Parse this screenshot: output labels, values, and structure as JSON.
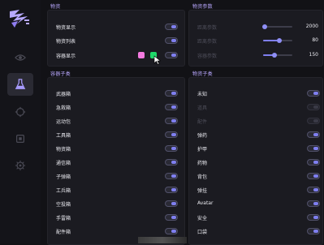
{
  "sidebar": {
    "logo": "app-logo",
    "items": [
      {
        "icon": "eye-icon",
        "active": false
      },
      {
        "icon": "flask-icon",
        "active": true
      },
      {
        "icon": "crosshair-icon",
        "active": false
      },
      {
        "icon": "chip-icon",
        "active": false
      },
      {
        "icon": "gear-icon",
        "active": false
      }
    ]
  },
  "item_display": {
    "title": "物资",
    "rows": [
      {
        "label": "物资显示",
        "on": true
      },
      {
        "label": "物资列表",
        "on": true
      },
      {
        "label": "容器显示",
        "on": true
      }
    ],
    "swatches": [
      "#f47ae0",
      "#1ed96a"
    ]
  },
  "item_params": {
    "title": "物资参数",
    "sliders": [
      {
        "label": "距离参数",
        "value": "2000",
        "fraction": 0.05
      },
      {
        "label": "距离参数",
        "value": "80",
        "fraction": 0.55
      },
      {
        "label": "容器参数",
        "value": "150",
        "fraction": 0.4
      }
    ]
  },
  "container_types": {
    "title": "容器子类",
    "rows": [
      {
        "label": "武器箱",
        "on": true
      },
      {
        "label": "急救箱",
        "on": true
      },
      {
        "label": "运动包",
        "on": true
      },
      {
        "label": "工具箱",
        "on": true
      },
      {
        "label": "物资箱",
        "on": true
      },
      {
        "label": "通信箱",
        "on": true
      },
      {
        "label": "子弹箱",
        "on": true
      },
      {
        "label": "工兵箱",
        "on": true
      },
      {
        "label": "空投箱",
        "on": true
      },
      {
        "label": "手雷箱",
        "on": true
      },
      {
        "label": "配件箱",
        "on": true
      }
    ]
  },
  "item_types": {
    "title": "物资子类",
    "rows": [
      {
        "label": "未知",
        "on": true,
        "disabled": false
      },
      {
        "label": "道具",
        "on": true,
        "disabled": true
      },
      {
        "label": "配件",
        "on": true,
        "disabled": true
      },
      {
        "label": "弹药",
        "on": true,
        "disabled": false
      },
      {
        "label": "护甲",
        "on": true,
        "disabled": false
      },
      {
        "label": "药物",
        "on": true,
        "disabled": false
      },
      {
        "label": "背包",
        "on": true,
        "disabled": false
      },
      {
        "label": "弹挂",
        "on": true,
        "disabled": false
      },
      {
        "label": "Avatar",
        "on": true,
        "disabled": false
      },
      {
        "label": "安全",
        "on": true,
        "disabled": false
      },
      {
        "label": "口袋",
        "on": true,
        "disabled": false
      }
    ]
  }
}
